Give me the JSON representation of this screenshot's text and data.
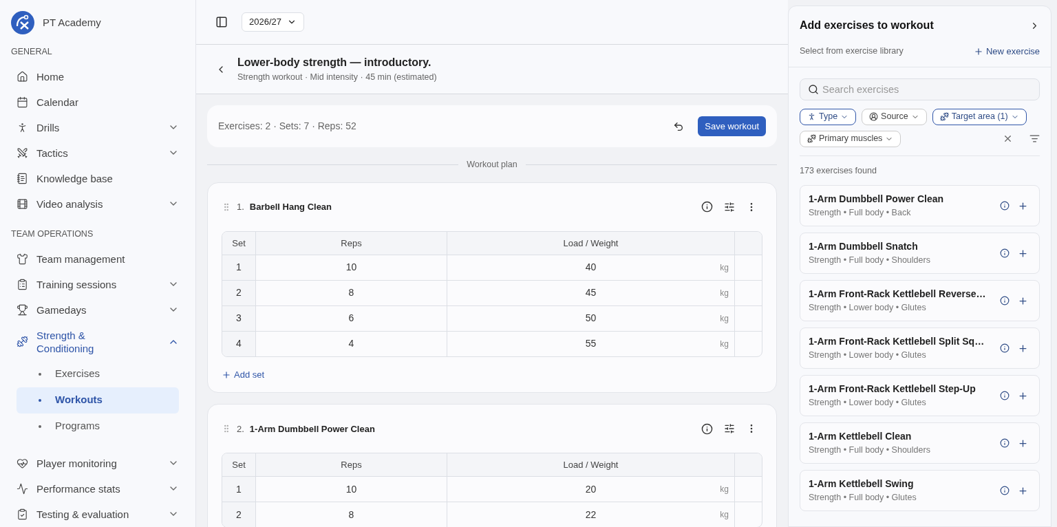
{
  "brand": {
    "name": "PT Academy"
  },
  "sidebar": {
    "sections": [
      {
        "title": "GENERAL",
        "items": [
          {
            "label": "Home"
          },
          {
            "label": "Calendar"
          },
          {
            "label": "Drills",
            "expanded": false
          },
          {
            "label": "Tactics",
            "expanded": false
          },
          {
            "label": "Knowledge base"
          },
          {
            "label": "Video analysis",
            "expanded": false
          }
        ]
      },
      {
        "title": "TEAM OPERATIONS",
        "items": [
          {
            "label": "Team management"
          },
          {
            "label": "Training sessions",
            "expanded": false
          },
          {
            "label": "Gamedays",
            "expanded": false
          },
          {
            "label": "Strength & Conditioning",
            "expanded": true,
            "children": [
              {
                "label": "Exercises",
                "selected": false
              },
              {
                "label": "Workouts",
                "selected": true
              },
              {
                "label": "Programs",
                "selected": false
              }
            ]
          },
          {
            "label": "Player monitoring",
            "expanded": false
          },
          {
            "label": "Performance stats",
            "expanded": false
          },
          {
            "label": "Testing & evaluation",
            "expanded": false
          }
        ]
      }
    ]
  },
  "topbar": {
    "season": "2026/27"
  },
  "workout": {
    "title": "Lower-body strength — introductory.",
    "subtitle": "Strength workout · Mid intensity · 45 min (estimated)",
    "summary": "Exercises: 2 · Sets: 7 · Reps: 52",
    "save_button": "Save workout",
    "divider_label": "Workout plan",
    "add_set": "Add set",
    "exercises": [
      {
        "number": "1.",
        "name": "Barbell Hang Clean",
        "columns": [
          "Set",
          "Reps",
          "Load / Weight"
        ],
        "rows": [
          {
            "set": "1",
            "reps": "10",
            "load": "40",
            "unit": "kg"
          },
          {
            "set": "2",
            "reps": "8",
            "load": "45",
            "unit": "kg"
          },
          {
            "set": "3",
            "reps": "6",
            "load": "50",
            "unit": "kg"
          },
          {
            "set": "4",
            "reps": "4",
            "load": "55",
            "unit": "kg"
          }
        ]
      },
      {
        "number": "2.",
        "name": "1-Arm Dumbbell Power Clean",
        "columns": [
          "Set",
          "Reps",
          "Load / Weight"
        ],
        "rows": [
          {
            "set": "1",
            "reps": "10",
            "load": "20",
            "unit": "kg"
          },
          {
            "set": "2",
            "reps": "8",
            "load": "22",
            "unit": "kg"
          }
        ]
      }
    ]
  },
  "panel": {
    "title": "Add exercises to workout",
    "subtitle": "Select from exercise library",
    "new_button": "New exercise",
    "search": {
      "placeholder": "Search exercises"
    },
    "filters": [
      {
        "label": "Type",
        "active": true
      },
      {
        "label": "Source",
        "active": false
      },
      {
        "label": "Target area (1)",
        "active": true
      },
      {
        "label": "Primary muscles",
        "active": false
      }
    ],
    "count": "173 exercises found",
    "results": [
      {
        "name": "1-Arm Dumbbell Power Clean",
        "meta": "Strength • Full body • Back"
      },
      {
        "name": "1-Arm Dumbbell Snatch",
        "meta": "Strength • Full body • Shoulders"
      },
      {
        "name": "1-Arm Front-Rack Kettlebell Reverse…",
        "meta": "Strength • Lower body • Glutes"
      },
      {
        "name": "1-Arm Front-Rack Kettlebell Split Sq…",
        "meta": "Strength • Lower body • Glutes"
      },
      {
        "name": "1-Arm Front-Rack Kettlebell Step-Up",
        "meta": "Strength • Lower body • Glutes"
      },
      {
        "name": "1-Arm Kettlebell Clean",
        "meta": "Strength • Full body • Shoulders"
      },
      {
        "name": "1-Arm Kettlebell Swing",
        "meta": "Strength • Full body • Glutes"
      }
    ]
  }
}
